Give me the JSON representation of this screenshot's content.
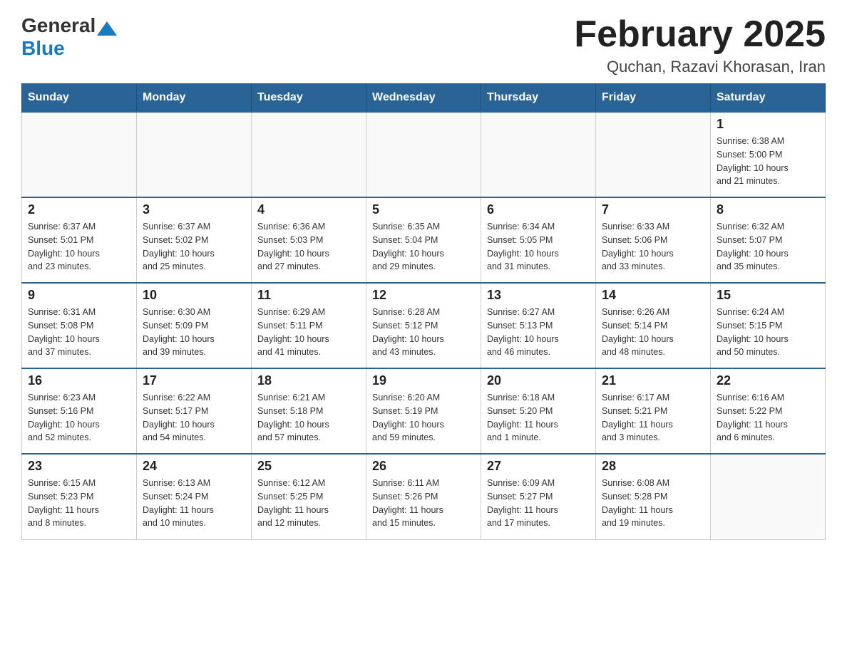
{
  "header": {
    "logo_general": "General",
    "logo_blue": "Blue",
    "month_title": "February 2025",
    "location": "Quchan, Razavi Khorasan, Iran"
  },
  "weekdays": [
    "Sunday",
    "Monday",
    "Tuesday",
    "Wednesday",
    "Thursday",
    "Friday",
    "Saturday"
  ],
  "weeks": [
    [
      {
        "day": "",
        "info": ""
      },
      {
        "day": "",
        "info": ""
      },
      {
        "day": "",
        "info": ""
      },
      {
        "day": "",
        "info": ""
      },
      {
        "day": "",
        "info": ""
      },
      {
        "day": "",
        "info": ""
      },
      {
        "day": "1",
        "info": "Sunrise: 6:38 AM\nSunset: 5:00 PM\nDaylight: 10 hours\nand 21 minutes."
      }
    ],
    [
      {
        "day": "2",
        "info": "Sunrise: 6:37 AM\nSunset: 5:01 PM\nDaylight: 10 hours\nand 23 minutes."
      },
      {
        "day": "3",
        "info": "Sunrise: 6:37 AM\nSunset: 5:02 PM\nDaylight: 10 hours\nand 25 minutes."
      },
      {
        "day": "4",
        "info": "Sunrise: 6:36 AM\nSunset: 5:03 PM\nDaylight: 10 hours\nand 27 minutes."
      },
      {
        "day": "5",
        "info": "Sunrise: 6:35 AM\nSunset: 5:04 PM\nDaylight: 10 hours\nand 29 minutes."
      },
      {
        "day": "6",
        "info": "Sunrise: 6:34 AM\nSunset: 5:05 PM\nDaylight: 10 hours\nand 31 minutes."
      },
      {
        "day": "7",
        "info": "Sunrise: 6:33 AM\nSunset: 5:06 PM\nDaylight: 10 hours\nand 33 minutes."
      },
      {
        "day": "8",
        "info": "Sunrise: 6:32 AM\nSunset: 5:07 PM\nDaylight: 10 hours\nand 35 minutes."
      }
    ],
    [
      {
        "day": "9",
        "info": "Sunrise: 6:31 AM\nSunset: 5:08 PM\nDaylight: 10 hours\nand 37 minutes."
      },
      {
        "day": "10",
        "info": "Sunrise: 6:30 AM\nSunset: 5:09 PM\nDaylight: 10 hours\nand 39 minutes."
      },
      {
        "day": "11",
        "info": "Sunrise: 6:29 AM\nSunset: 5:11 PM\nDaylight: 10 hours\nand 41 minutes."
      },
      {
        "day": "12",
        "info": "Sunrise: 6:28 AM\nSunset: 5:12 PM\nDaylight: 10 hours\nand 43 minutes."
      },
      {
        "day": "13",
        "info": "Sunrise: 6:27 AM\nSunset: 5:13 PM\nDaylight: 10 hours\nand 46 minutes."
      },
      {
        "day": "14",
        "info": "Sunrise: 6:26 AM\nSunset: 5:14 PM\nDaylight: 10 hours\nand 48 minutes."
      },
      {
        "day": "15",
        "info": "Sunrise: 6:24 AM\nSunset: 5:15 PM\nDaylight: 10 hours\nand 50 minutes."
      }
    ],
    [
      {
        "day": "16",
        "info": "Sunrise: 6:23 AM\nSunset: 5:16 PM\nDaylight: 10 hours\nand 52 minutes."
      },
      {
        "day": "17",
        "info": "Sunrise: 6:22 AM\nSunset: 5:17 PM\nDaylight: 10 hours\nand 54 minutes."
      },
      {
        "day": "18",
        "info": "Sunrise: 6:21 AM\nSunset: 5:18 PM\nDaylight: 10 hours\nand 57 minutes."
      },
      {
        "day": "19",
        "info": "Sunrise: 6:20 AM\nSunset: 5:19 PM\nDaylight: 10 hours\nand 59 minutes."
      },
      {
        "day": "20",
        "info": "Sunrise: 6:18 AM\nSunset: 5:20 PM\nDaylight: 11 hours\nand 1 minute."
      },
      {
        "day": "21",
        "info": "Sunrise: 6:17 AM\nSunset: 5:21 PM\nDaylight: 11 hours\nand 3 minutes."
      },
      {
        "day": "22",
        "info": "Sunrise: 6:16 AM\nSunset: 5:22 PM\nDaylight: 11 hours\nand 6 minutes."
      }
    ],
    [
      {
        "day": "23",
        "info": "Sunrise: 6:15 AM\nSunset: 5:23 PM\nDaylight: 11 hours\nand 8 minutes."
      },
      {
        "day": "24",
        "info": "Sunrise: 6:13 AM\nSunset: 5:24 PM\nDaylight: 11 hours\nand 10 minutes."
      },
      {
        "day": "25",
        "info": "Sunrise: 6:12 AM\nSunset: 5:25 PM\nDaylight: 11 hours\nand 12 minutes."
      },
      {
        "day": "26",
        "info": "Sunrise: 6:11 AM\nSunset: 5:26 PM\nDaylight: 11 hours\nand 15 minutes."
      },
      {
        "day": "27",
        "info": "Sunrise: 6:09 AM\nSunset: 5:27 PM\nDaylight: 11 hours\nand 17 minutes."
      },
      {
        "day": "28",
        "info": "Sunrise: 6:08 AM\nSunset: 5:28 PM\nDaylight: 11 hours\nand 19 minutes."
      },
      {
        "day": "",
        "info": ""
      }
    ]
  ]
}
